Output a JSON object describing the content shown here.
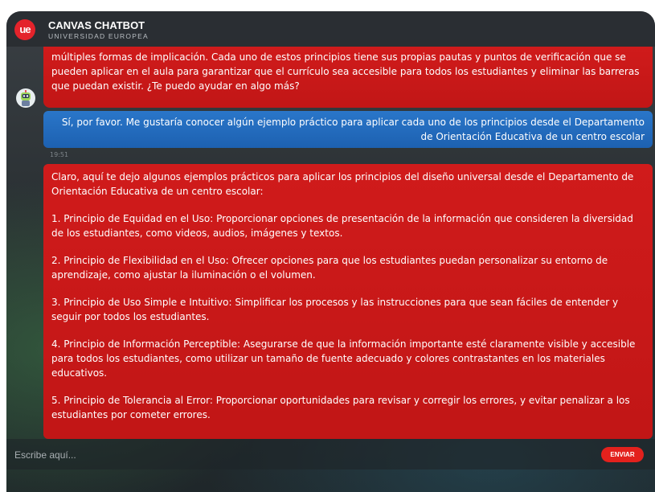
{
  "header": {
    "logo_text": "ue",
    "title": "CANVAS CHATBOT",
    "subtitle": "UNIVERSIDAD EUROPEA"
  },
  "colors": {
    "bot_bubble": "#c81919",
    "user_bubble": "#2168b8",
    "send_button": "#e3211d",
    "logo": "#e4232b"
  },
  "avatar_icon": "robot-avatar-icon",
  "messages": {
    "bot_1": "múltiples formas de implicación. Cada uno de estos principios tiene sus propias pautas y puntos de verificación que se pueden aplicar en el aula para garantizar que el currículo sea accesible para todos los estudiantes y eliminar las barreras que puedan existir. ¿Te puedo ayudar en algo más?",
    "user_1": "Sí, por favor. Me gustaría conocer algún ejemplo práctico para aplicar cada uno de los principios desde el Departamento de Orientación Educativa de un centro escolar",
    "timestamp": "19:51",
    "bot_2": [
      "Claro, aquí te dejo algunos ejemplos prácticos para aplicar los principios del diseño universal desde el Departamento de Orientación Educativa de un centro escolar:",
      "1. Principio de Equidad en el Uso: Proporcionar opciones de presentación de la información que consideren la diversidad de los estudiantes, como videos, audios, imágenes y textos.",
      "2. Principio de Flexibilidad en el Uso: Ofrecer opciones para que los estudiantes puedan personalizar su entorno de aprendizaje, como ajustar la iluminación o el volumen.",
      "3. Principio de Uso Simple e Intuitivo: Simplificar los procesos y las instrucciones para que sean fáciles de entender y seguir por todos los estudiantes.",
      "4. Principio de Información Perceptible: Asegurarse de que la información importante esté claramente visible y accesible para todos los estudiantes, como utilizar un tamaño de fuente adecuado y colores contrastantes en los materiales educativos.",
      "5. Principio de Tolerancia al Error: Proporcionar oportunidades para revisar y corregir los errores, y evitar penalizar a los estudiantes por cometer errores."
    ]
  },
  "input": {
    "placeholder": "Escribe aquí...",
    "value": "",
    "send_label": "ENVIAR"
  }
}
